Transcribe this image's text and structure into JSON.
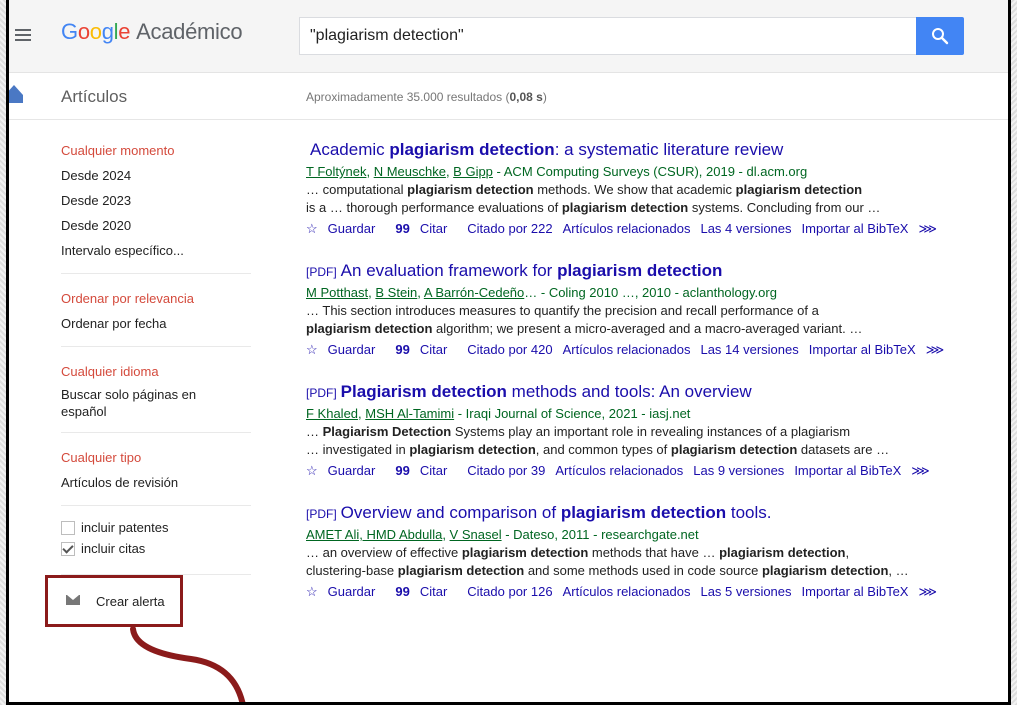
{
  "header": {
    "logo_parts": [
      "G",
      "o",
      "o",
      "g",
      "l",
      "e"
    ],
    "product": "Académico",
    "search_value": "\"plagiarism detection\"",
    "search_placeholder": ""
  },
  "subheader": {
    "section": "Artículos",
    "stats_prefix": "Aproximadamente 35.000 resultados (",
    "stats_time": "0,08 s",
    "stats_suffix": ")"
  },
  "sidebar": {
    "time": [
      "Cualquier momento",
      "Desde 2024",
      "Desde 2023",
      "Desde 2020",
      "Intervalo específico..."
    ],
    "sort": [
      "Ordenar por relevancia",
      "Ordenar por fecha"
    ],
    "lang": [
      "Cualquier idioma",
      "Buscar solo páginas en español"
    ],
    "type": [
      "Cualquier tipo",
      "Artículos de revisión"
    ],
    "patents": "incluir patentes",
    "citations": "incluir citas",
    "alert": "Crear alerta"
  },
  "links": {
    "save": "Guardar",
    "cite": "Citar",
    "related": "Artículos relacionados",
    "bibtex": "Importar al BibTeX",
    "more": "⋙"
  },
  "results": [
    {
      "pdf": "",
      "title_pre": "Academic ",
      "title_bold": "plagiarism detection",
      "title_post": ": a systematic literature review",
      "authors": [
        "T Foltýnek",
        ", ",
        "N Meuschke",
        ", ",
        "B Gipp"
      ],
      "source": " - ACM Computing Surveys (CSUR), 2019 - dl.acm.org",
      "snip1": [
        "… computational ",
        "plagiarism detection",
        " methods. We show that academic ",
        "plagiarism detection",
        ""
      ],
      "snip2": [
        "is a … thorough performance evaluations of ",
        "plagiarism detection",
        " systems. Concluding from our …",
        "",
        ""
      ],
      "cited": "Citado por 222",
      "versions": "Las 4 versiones"
    },
    {
      "pdf": "[PDF]",
      "title_pre": "An evaluation framework for ",
      "title_bold": "plagiarism detection",
      "title_post": "",
      "authors": [
        "M Potthast",
        ", ",
        "B Stein",
        ", ",
        "A Barrón-Cedeño"
      ],
      "source": "… - Coling 2010 …, 2010 - aclanthology.org",
      "snip1": [
        "… This section introduces measures to quantify the precision and recall performance of a",
        "",
        "",
        "",
        ""
      ],
      "snip2": [
        "",
        "plagiarism detection",
        " algorithm; we present a micro-averaged and a macro-averaged variant. …",
        "",
        ""
      ],
      "cited": "Citado por 420",
      "versions": "Las 14 versiones"
    },
    {
      "pdf": "[PDF]",
      "title_pre": "",
      "title_bold": "Plagiarism detection",
      "title_post": " methods and tools: An overview",
      "authors": [
        "F Khaled",
        ", ",
        "MSH Al-Tamimi",
        "",
        ""
      ],
      "source": " - Iraqi Journal of Science, 2021 - iasj.net",
      "snip1": [
        "… ",
        "Plagiarism Detection",
        " Systems play an important role in revealing instances of a plagiarism",
        "",
        ""
      ],
      "snip2": [
        "… investigated in ",
        "plagiarism detection",
        ", and common types of ",
        "plagiarism detection",
        " datasets are …"
      ],
      "cited": "Citado por 39",
      "versions": "Las 9 versiones"
    },
    {
      "pdf": "[PDF]",
      "title_pre": "Overview and comparison of ",
      "title_bold": "plagiarism detection",
      "title_post": " tools.",
      "authors": [
        "AMET Ali, HMD Abdulla",
        ", ",
        "V Snasel",
        "",
        ""
      ],
      "source": " - Dateso, 2011 - researchgate.net",
      "snip1": [
        "… an overview of effective ",
        "plagiarism detection",
        " methods that have … ",
        "plagiarism detection",
        ","
      ],
      "snip2": [
        "clustering-base ",
        "plagiarism detection",
        " and some methods used in code source ",
        "plagiarism detection",
        ", …"
      ],
      "cited": "Citado por 126",
      "versions": "Las 5 versiones"
    }
  ],
  "colors": {
    "link": "#1a0dab",
    "author": "#006621",
    "accent": "#d44a3c",
    "search_button": "#4285f4",
    "highlight_box": "#8b1b1b"
  }
}
